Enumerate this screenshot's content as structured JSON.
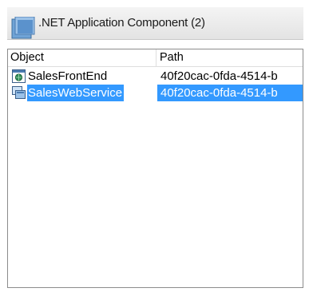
{
  "header": {
    "title": ".NET Application Component (2)",
    "icon": "component-icon"
  },
  "table": {
    "columns": [
      "Object",
      "Path"
    ],
    "rows": [
      {
        "name": "SalesFrontEnd",
        "path": "40f20cac-0fda-4514-b",
        "icon": "web-app-icon",
        "selected": false
      },
      {
        "name": "SalesWebService",
        "path": "40f20cac-0fda-4514-b",
        "icon": "web-service-icon",
        "selected": true
      }
    ]
  },
  "colors": {
    "selection": "#3399ff",
    "border": "#8c8c8c"
  }
}
